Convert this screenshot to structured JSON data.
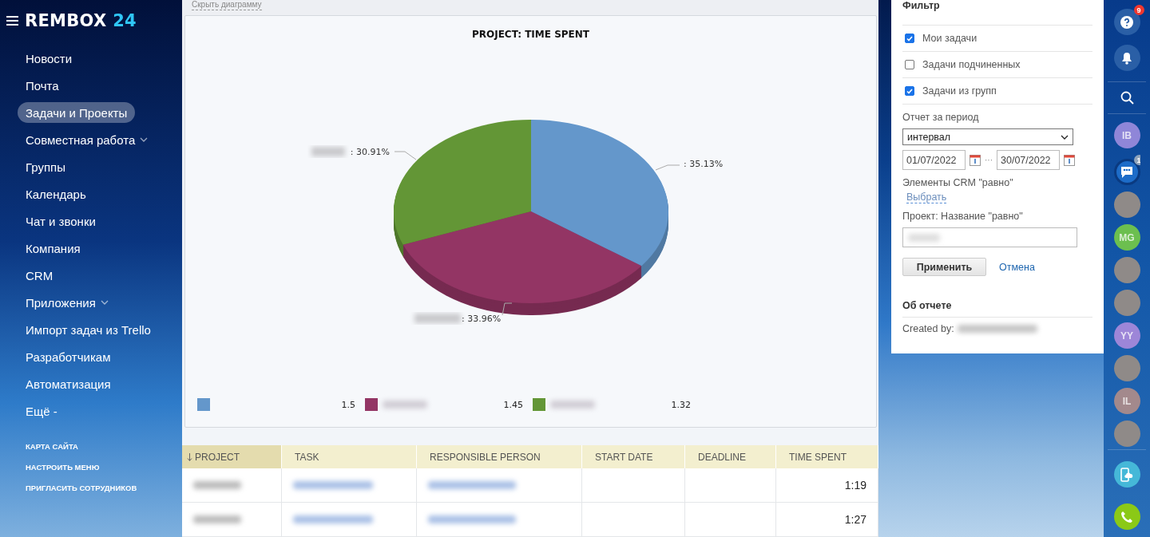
{
  "sidebar": {
    "logo": {
      "name": "REMBOX",
      "number": "24"
    },
    "items": [
      {
        "label": "Новости",
        "selected": false,
        "dropdown": false
      },
      {
        "label": "Почта",
        "selected": false,
        "dropdown": false
      },
      {
        "label": "Задачи и Проекты",
        "selected": true,
        "dropdown": false
      },
      {
        "label": "Совместная работа",
        "selected": false,
        "dropdown": true
      },
      {
        "label": "Группы",
        "selected": false,
        "dropdown": false
      },
      {
        "label": "Календарь",
        "selected": false,
        "dropdown": false
      },
      {
        "label": "Чат и звонки",
        "selected": false,
        "dropdown": false
      },
      {
        "label": "Компания",
        "selected": false,
        "dropdown": false
      },
      {
        "label": "CRM",
        "selected": false,
        "dropdown": false
      },
      {
        "label": "Приложения",
        "selected": false,
        "dropdown": true
      },
      {
        "label": "Импорт задач из Trello",
        "selected": false,
        "dropdown": false
      },
      {
        "label": "Разработчикам",
        "selected": false,
        "dropdown": false
      },
      {
        "label": "Автоматизация",
        "selected": false,
        "dropdown": false
      },
      {
        "label": "Ещё -",
        "selected": false,
        "dropdown": false
      }
    ],
    "footer_links": [
      "КАРТА САЙТА",
      "НАСТРОИТЬ МЕНЮ",
      "ПРИГЛАСИТЬ СОТРУДНИКОВ"
    ]
  },
  "main": {
    "hide_chart_link": "Скрыть диаграмму",
    "chart": {
      "chart_data": {
        "type": "pie",
        "title": "PROJECT: TIME SPENT",
        "values": [
          35.13,
          33.96,
          30.91
        ],
        "value_labels": [
          ": 35.13%",
          ": 33.96%",
          ": 30.91%"
        ]
      },
      "legend": [
        {
          "color": "#6497cb",
          "value": "1.5",
          "blurred": false
        },
        {
          "color": "#933564",
          "value": "1.45",
          "blurred": true
        },
        {
          "color": "#639636",
          "value": "1.32",
          "blurred": true
        }
      ]
    },
    "table": {
      "columns": [
        {
          "label": "PROJECT",
          "sorted": true
        },
        {
          "label": "TASK",
          "sorted": false
        },
        {
          "label": "RESPONSIBLE PERSON",
          "sorted": false
        },
        {
          "label": "START DATE",
          "sorted": false
        },
        {
          "label": "DEADLINE",
          "sorted": false
        },
        {
          "label": "TIME SPENT",
          "sorted": false
        }
      ],
      "rows": [
        {
          "time_spent": "1:19"
        },
        {
          "time_spent": "1:27"
        }
      ]
    }
  },
  "filter": {
    "title": "Фильтр",
    "checkboxes": [
      {
        "label": "Мои задачи",
        "checked": true
      },
      {
        "label": "Задачи подчиненных",
        "checked": false
      },
      {
        "label": "Задачи из групп",
        "checked": true
      }
    ],
    "period_label": "Отчет за период",
    "period_value": "интервал",
    "date_from": "01/07/2022",
    "date_separator": "···",
    "date_to": "30/07/2022",
    "crm_label": "Элементы CRM \"равно\"",
    "choose_link": "Выбрать",
    "project_label": "Проект: Название \"равно\"",
    "apply_button": "Применить",
    "cancel_link": "Отмена",
    "about_title": "Об отчете",
    "created_by": "Created by:"
  },
  "rail": {
    "top": [
      {
        "kind": "help",
        "badge": "9"
      },
      {
        "kind": "bell"
      },
      {
        "kind": "search"
      }
    ],
    "contacts": [
      {
        "kind": "initials",
        "text": "IB",
        "color": "#8f86d8"
      },
      {
        "kind": "chat",
        "badge": "1"
      },
      {
        "kind": "photo"
      },
      {
        "kind": "initials",
        "text": "MG",
        "color": "#6cbf4f"
      },
      {
        "kind": "photo"
      },
      {
        "kind": "photo"
      },
      {
        "kind": "initials",
        "text": "YY",
        "color": "#9d86d8"
      },
      {
        "kind": "photo"
      },
      {
        "kind": "initials",
        "text": "IL",
        "color": "#a3898c"
      },
      {
        "kind": "photo"
      }
    ],
    "bottom": [
      {
        "kind": "cloud"
      },
      {
        "kind": "call"
      }
    ]
  }
}
